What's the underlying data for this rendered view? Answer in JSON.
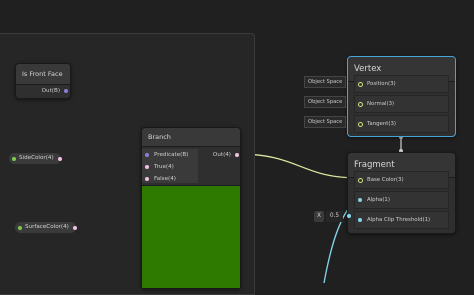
{
  "group": {},
  "is_front_face": {
    "title": "Is Front Face",
    "out_label": "Out(B)"
  },
  "branch": {
    "title": "Branch",
    "inputs": [
      "Predicate(B)",
      "True(4)",
      "False(4)"
    ],
    "output": "Out(4)",
    "preview_color": "#2e7a00"
  },
  "side_color": {
    "label": "SideColor(4)"
  },
  "surface_color": {
    "label": "SurfaceColor(4)"
  },
  "vertex": {
    "title": "Vertex",
    "space_label": "Object Space",
    "rows": [
      "Position(3)",
      "Normal(3)",
      "Tangent(3)"
    ]
  },
  "fragment": {
    "title": "Fragment",
    "rows": [
      "Base Color(3)",
      "Alpha(1)",
      "Alpha Clip Threshold(1)"
    ]
  },
  "alpha_clip_input": {
    "axis": "X",
    "value": "0.5"
  },
  "colors": {
    "bool_port": "#8a7fd8",
    "vec4_port": "#f0c0e0",
    "vec3_port": "#cfe080",
    "float_port": "#86d4ec",
    "vertex_outline": "#46a4d8"
  }
}
